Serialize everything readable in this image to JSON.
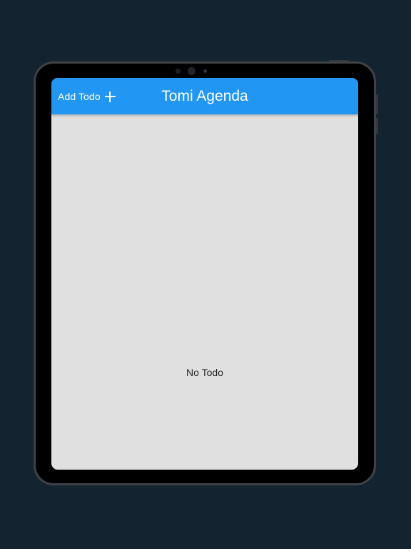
{
  "app": {
    "title": "Tomi Agenda",
    "add_button_label": "Add Todo",
    "add_button_icon": "plus-icon"
  },
  "body": {
    "empty_message": "No Todo"
  },
  "colors": {
    "background": "#13232f",
    "app_bar": "#2196f3",
    "screen": "#e0e0e0"
  }
}
